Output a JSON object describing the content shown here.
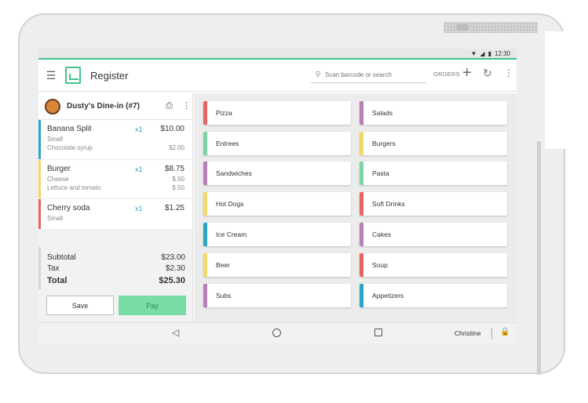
{
  "status": {
    "time": "12:30"
  },
  "app": {
    "title": "Register"
  },
  "search": {
    "placeholder": "Scan barcode or search"
  },
  "toolbar": {
    "orders_label": "ORDERS"
  },
  "ticket": {
    "title": "Dusty's Dine-in (#7)",
    "items": [
      {
        "name": "Banana Split",
        "qty": "x1",
        "price": "$10.00",
        "color": "#2aa5c8",
        "mods": [
          {
            "label": "Small",
            "price": ""
          },
          {
            "label": "Chocolate syrup",
            "price": "$2.00"
          }
        ]
      },
      {
        "name": "Burger",
        "qty": "x1",
        "price": "$8.75",
        "color": "#f2d96b",
        "mods": [
          {
            "label": "Cheese",
            "price": "$.50"
          },
          {
            "label": "Lettuce and tomato",
            "price": "$.50"
          }
        ]
      },
      {
        "name": "Cherry soda",
        "qty": "x1",
        "price": "$1.25",
        "color": "#e86464",
        "mods": [
          {
            "label": "Small",
            "price": ""
          }
        ]
      }
    ],
    "subtotal_label": "Subtotal",
    "subtotal": "$23.00",
    "tax_label": "Tax",
    "tax": "$2.30",
    "total_label": "Total",
    "total": "$25.30",
    "save_label": "Save",
    "pay_label": "Pay"
  },
  "categories": [
    {
      "label": "Pizza",
      "color": "#e86464"
    },
    {
      "label": "Salads",
      "color": "#b97fb8"
    },
    {
      "label": "Entrees",
      "color": "#7fd4a4"
    },
    {
      "label": "Burgers",
      "color": "#f2d96b"
    },
    {
      "label": "Sandwiches",
      "color": "#b97fb8"
    },
    {
      "label": "Pasta",
      "color": "#7fd4a4"
    },
    {
      "label": "Hot Dogs",
      "color": "#f2d96b"
    },
    {
      "label": "Soft Drinks",
      "color": "#e86464"
    },
    {
      "label": "Ice Cream",
      "color": "#2aa5c8"
    },
    {
      "label": "Cakes",
      "color": "#b97fb8"
    },
    {
      "label": "Beer",
      "color": "#f2d96b"
    },
    {
      "label": "Soup",
      "color": "#e86464"
    },
    {
      "label": "Subs",
      "color": "#b97fb8"
    },
    {
      "label": "Appetizers",
      "color": "#2aa5c8"
    }
  ],
  "navbar": {
    "user": "Christine"
  },
  "icons": {
    "menu": "menu-icon",
    "search": "search-icon",
    "plus": "plus-icon",
    "refresh": "refresh-icon",
    "more": "more-vert-icon",
    "print": "print-icon",
    "back": "back-icon",
    "home": "home-icon",
    "recents": "recents-icon",
    "lock": "lock-icon"
  }
}
